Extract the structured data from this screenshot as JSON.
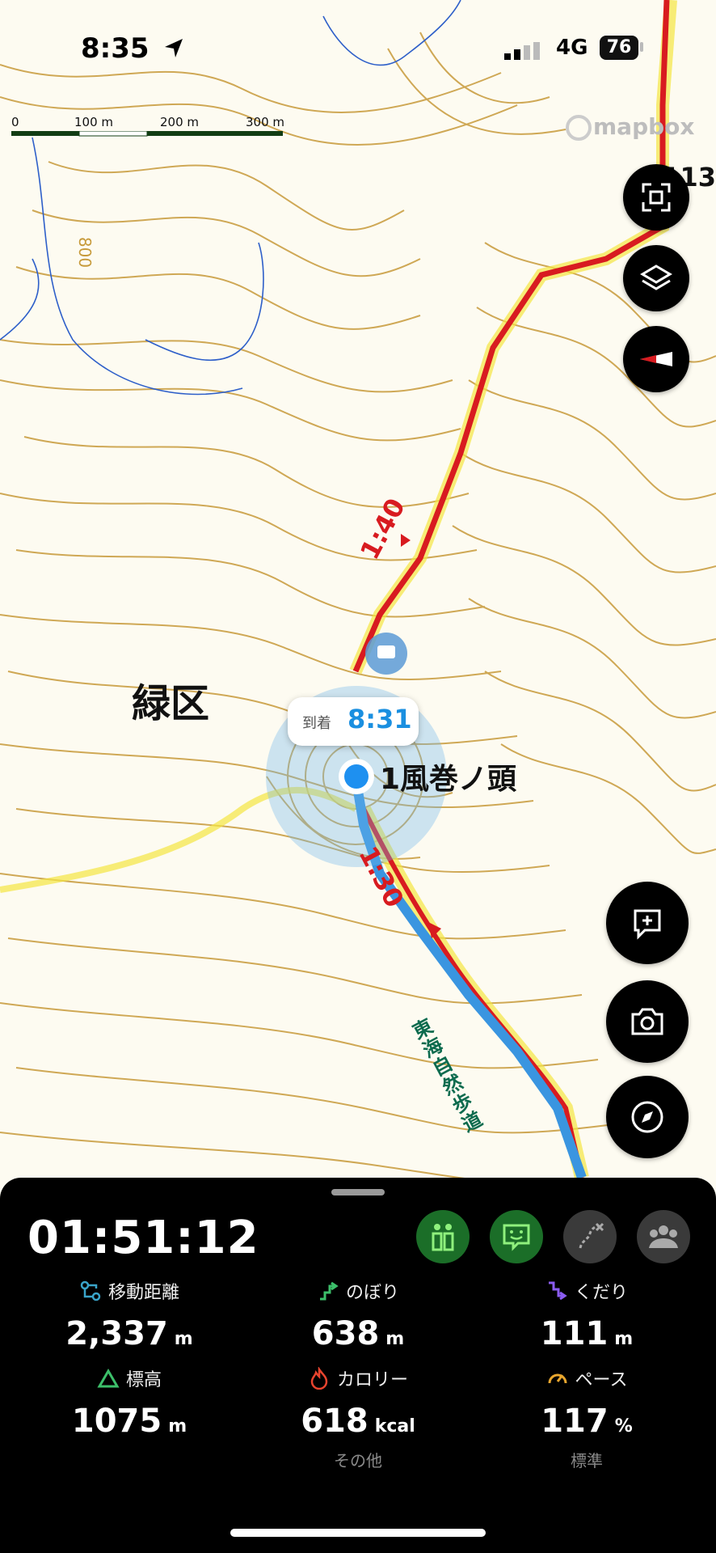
{
  "status_bar": {
    "time": "8:35",
    "network": "4G",
    "battery": "76"
  },
  "map": {
    "scale_labels": [
      "0",
      "100 m",
      "200 m",
      "300 m"
    ],
    "attribution": "mapbox",
    "contour_label": "800",
    "peak_label_partial": "113",
    "region_label": "緑区",
    "arrival": {
      "label": "到着",
      "time": "8:31"
    },
    "point_name": "1風巻ノ頭",
    "segment_times": [
      "1:40",
      "1:30"
    ],
    "trail_name": "東海自然歩道",
    "colors": {
      "route_red": "#d81b20",
      "route_blue": "#3a95e0",
      "contour": "#c79a3a",
      "trail_yellow": "#f4e542"
    }
  },
  "map_controls": [
    {
      "name": "fit-route-icon"
    },
    {
      "name": "layers-icon"
    },
    {
      "name": "compass-heading-icon"
    }
  ],
  "map_actions": [
    {
      "name": "add-memo-icon"
    },
    {
      "name": "camera-icon"
    },
    {
      "name": "navigation-compass-icon"
    }
  ],
  "panel": {
    "elapsed_time": "01:51:12",
    "chips": [
      "people-route-icon",
      "face-memo-icon",
      "route-off-icon",
      "group-icon"
    ],
    "stats": [
      {
        "label": "移動距離",
        "value": "2,337",
        "unit": "m",
        "icon": "distance-icon",
        "color": "#3aa4c9"
      },
      {
        "label": "のぼり",
        "value": "638",
        "unit": "m",
        "icon": "ascent-icon",
        "color": "#3cbf6a"
      },
      {
        "label": "くだり",
        "value": "111",
        "unit": "m",
        "icon": "descent-icon",
        "color": "#8a5cf0"
      },
      {
        "label": "標高",
        "value": "1075",
        "unit": "m",
        "icon": "elevation-icon",
        "color": "#3cbf6a"
      },
      {
        "label": "カロリー",
        "value": "618",
        "unit": "kcal",
        "icon": "calorie-icon",
        "color": "#e8442e"
      },
      {
        "label": "ペース",
        "value": "117",
        "unit": "%",
        "icon": "pace-icon",
        "color": "#e8a62e"
      }
    ],
    "sublabels": {
      "calorie": "その他",
      "pace": "標準"
    }
  }
}
